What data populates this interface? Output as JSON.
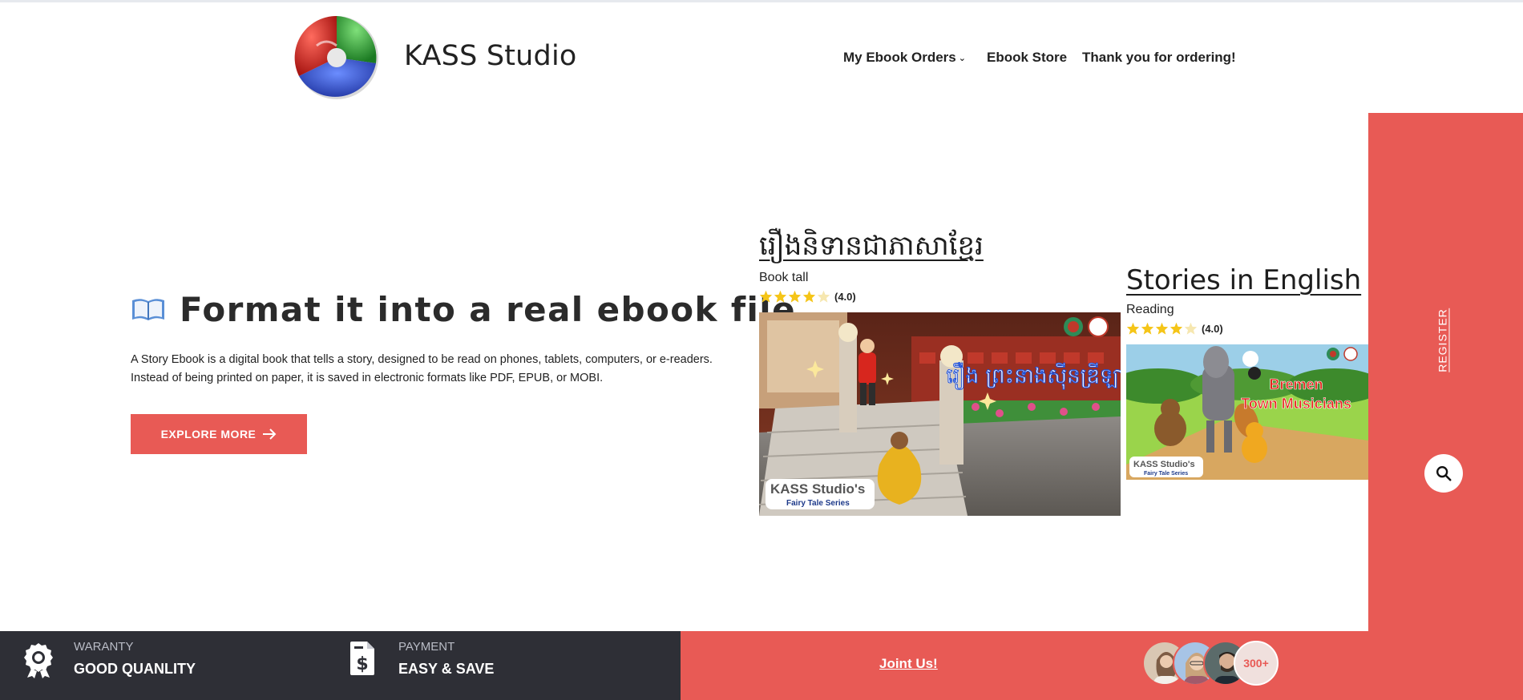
{
  "header": {
    "brand": "KASS Studio",
    "nav": [
      {
        "label": "My Ebook Orders"
      },
      {
        "label": "Ebook Store"
      },
      {
        "label": "Thank you for ordering!"
      }
    ]
  },
  "side": {
    "register_label": "REGISTER"
  },
  "hero": {
    "title": "Format it into a real ebook file",
    "description_line1": "A Story Ebook is a digital book that tells a story, designed to be read on phones, tablets, computers, or e-readers.",
    "description_line2": "Instead of being printed on paper, it is saved in electronic formats like PDF, EPUB, or MOBI.",
    "button_label": "EXPLORE MORE"
  },
  "cards": [
    {
      "category": "រឿងនិទានជាភាសាខ្មែរ",
      "book": "Book tall",
      "rating": 4,
      "rating_text": "(4.0)",
      "image_title": "រឿង ព្រះនាងស៊ីនឌ្រីឡា",
      "image_brand": "KASS Studio's",
      "image_series": "Fairy Tale Series"
    },
    {
      "category": "Stories in English",
      "book": "Reading",
      "rating": 4,
      "rating_text": "(4.0)",
      "image_title_line1": "Bremen",
      "image_title_line2": "Town Musicians",
      "image_brand": "KASS Studio's",
      "image_series": "Fairy Tale Series"
    }
  ],
  "features": [
    {
      "label": "WARANTY",
      "value": "GOOD QUANLITY",
      "icon": "award-icon"
    },
    {
      "label": "PAYMENT",
      "value": "EASY & SAVE",
      "icon": "dollar-document-icon"
    }
  ],
  "community": {
    "join_label": "Joint Us!",
    "count_label": "300+"
  },
  "colors": {
    "accent": "#e85a55",
    "dark": "#2e2f36",
    "star": "#f5c518"
  }
}
